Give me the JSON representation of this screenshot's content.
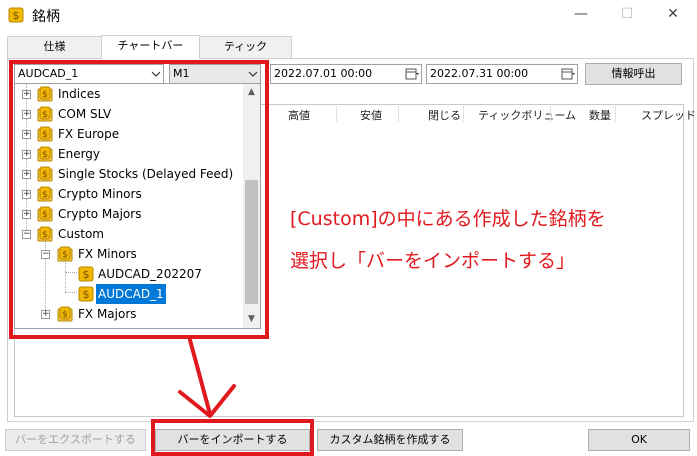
{
  "window": {
    "title": "銘柄",
    "minimize": "—",
    "maximize": "☐",
    "close": "✕"
  },
  "tabs": [
    {
      "label": "仕様",
      "active": false
    },
    {
      "label": "チャートバー",
      "active": true
    },
    {
      "label": "ティック",
      "active": false
    }
  ],
  "toolbar": {
    "symbol_value": "AUDCAD_1",
    "timeframe_value": "M1",
    "date_from": "2022.07.01 00:00",
    "date_to": "2022.07.31 00:00",
    "request_label": "情報呼出"
  },
  "table": {
    "headers": [
      "高値",
      "安値",
      "閉じる",
      "ティックボリューム",
      "数量",
      "スプレッド"
    ]
  },
  "tree": {
    "items": [
      {
        "label": "Indices",
        "level": 0,
        "expander": "+"
      },
      {
        "label": "COM SLV",
        "level": 0,
        "expander": "+"
      },
      {
        "label": "FX Europe",
        "level": 0,
        "expander": "+"
      },
      {
        "label": "Energy",
        "level": 0,
        "expander": "+"
      },
      {
        "label": "Single Stocks (Delayed Feed)",
        "level": 0,
        "expander": "+"
      },
      {
        "label": "Crypto Minors",
        "level": 0,
        "expander": "+"
      },
      {
        "label": "Crypto Majors",
        "level": 0,
        "expander": "+"
      },
      {
        "label": "Custom",
        "level": 0,
        "expander": "−"
      },
      {
        "label": "FX Minors",
        "level": 1,
        "expander": "−"
      },
      {
        "label": "AUDCAD_202207",
        "level": 2,
        "expander": ""
      },
      {
        "label": "AUDCAD_1",
        "level": 2,
        "expander": "",
        "selected": true
      },
      {
        "label": "FX Majors",
        "level": 1,
        "expander": "+"
      }
    ]
  },
  "annotation": {
    "line1": "[Custom]の中にある作成した銘柄を",
    "line2": "選択し「バーをインポートする」",
    "color": "#e0191f"
  },
  "buttons": {
    "export": "バーをエクスポートする",
    "import": "バーをインポートする",
    "custom": "カスタム銘柄を作成する",
    "ok": "OK"
  },
  "icons": {
    "app": "coin-icon",
    "folder": "coin-folder-icon",
    "symbol": "coin-symbol-icon"
  },
  "colors": {
    "coin": "#f2b705",
    "selection": "#0078d7",
    "accent_red": "#e0191f"
  }
}
